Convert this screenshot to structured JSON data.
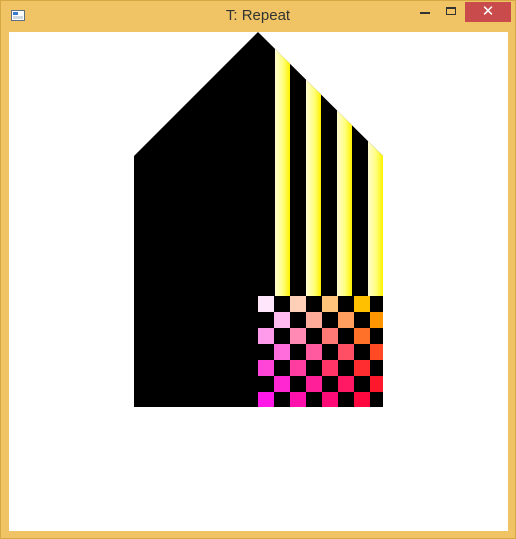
{
  "window": {
    "title": "T: Repeat",
    "close_symbol": "✕",
    "icons": {
      "app": "application-window-icon",
      "minimize": "minimize-icon",
      "maximize": "maximize-icon",
      "close": "close-icon"
    }
  },
  "colors": {
    "window_frame": "#f0c465",
    "close_button": "#c94b4b",
    "client_background": "#ffffff",
    "shape_fill": "#000000"
  },
  "canvas": {
    "shape": "black house-shaped polygon with repeated yellow stripes and a magenta-to-orange checker pattern"
  }
}
